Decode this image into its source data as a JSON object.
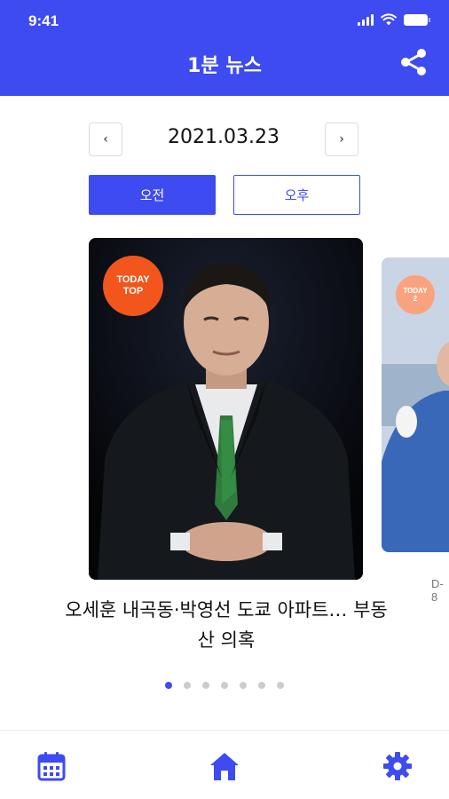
{
  "status_bar": {
    "time": "9:41"
  },
  "header": {
    "title": "1분 뉴스",
    "share_icon": "share-icon"
  },
  "date_nav": {
    "prev_label": "‹",
    "date": "2021.03.23",
    "next_label": "›"
  },
  "segments": [
    {
      "label": "오전",
      "selected": true
    },
    {
      "label": "오후",
      "selected": false
    }
  ],
  "cards": [
    {
      "badge_line1": "TODAY",
      "badge_line2": "TOP",
      "headline": "오세훈 내곡동·박영선 도쿄 아파트… 부동산 의혹"
    },
    {
      "badge_line1": "TODAY",
      "badge_line2": "2",
      "label": "D-8"
    }
  ],
  "pagination": {
    "count": 7,
    "active_index": 0
  },
  "bottom_nav": [
    {
      "name": "calendar",
      "icon": "calendar-icon"
    },
    {
      "name": "home",
      "icon": "home-icon",
      "active": true
    },
    {
      "name": "settings",
      "icon": "gear-icon"
    }
  ],
  "colors": {
    "primary": "#3d4bf0",
    "badge": "#f2561d",
    "dot_inactive": "#cccccc"
  }
}
